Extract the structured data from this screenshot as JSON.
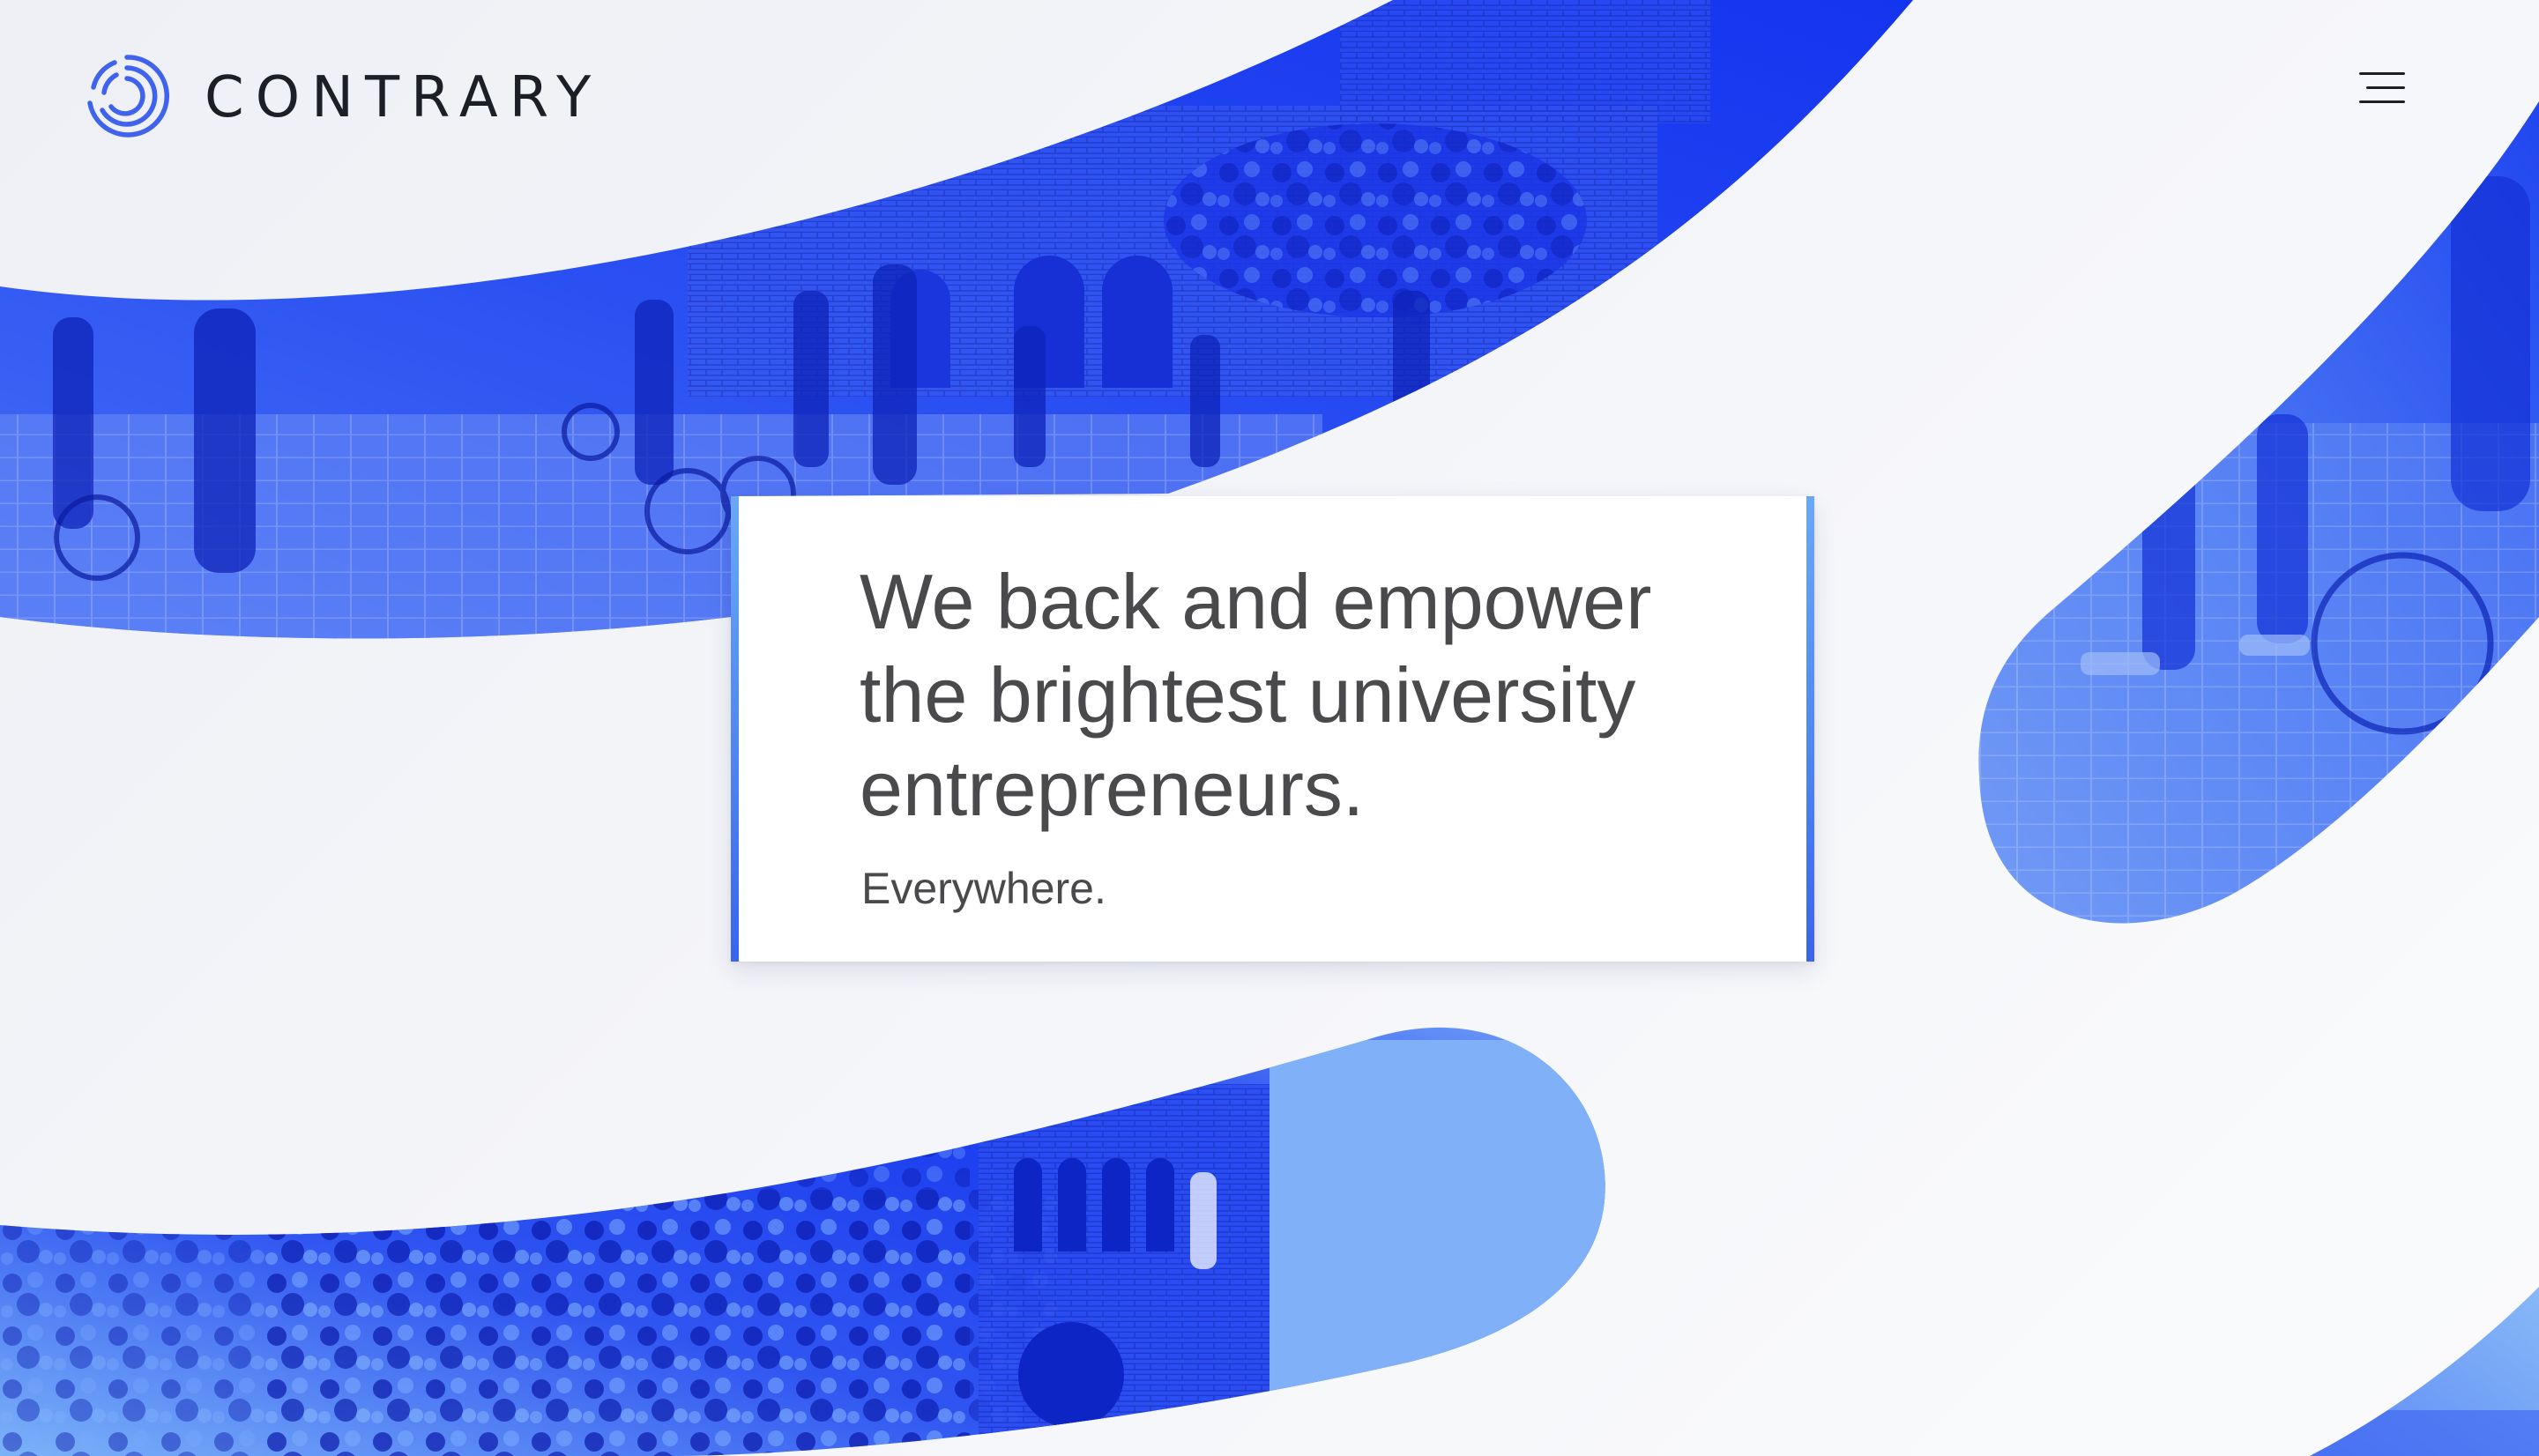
{
  "brand": {
    "name": "CONTRARY",
    "logo_icon": "contrary-ring-logo-icon",
    "text_color": "#1d1f26"
  },
  "header": {
    "menu_icon": "hamburger-menu-icon"
  },
  "hero": {
    "headline": "We back and empower\nthe brightest university\nentrepreneurs.",
    "subheadline": "Everywhere.",
    "text_color": "#4a4a4c",
    "accent_gradient": [
      "#6aa8f5",
      "#3b64ea"
    ]
  },
  "background": {
    "photo_tint_deep": "#1f3cf2",
    "photo_tint_light": "#7aaaf5",
    "page_color": "#f2f3f7"
  }
}
